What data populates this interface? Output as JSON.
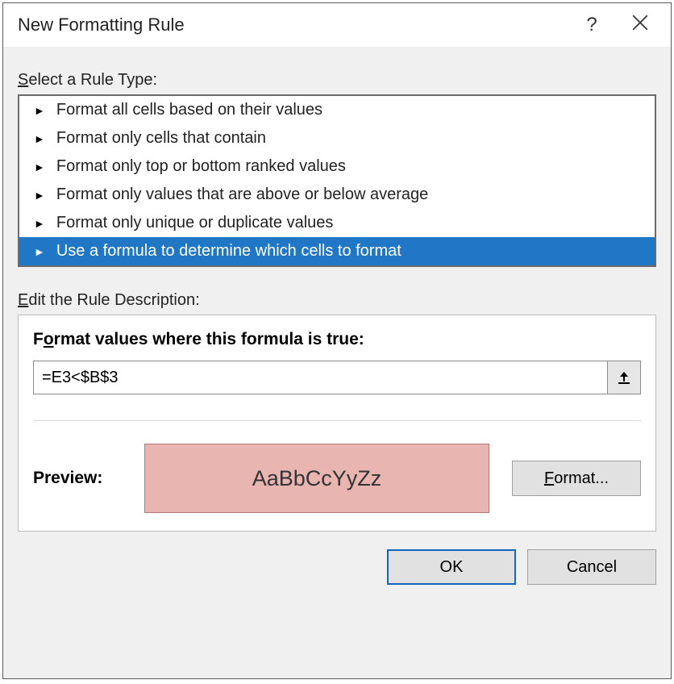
{
  "titlebar": {
    "title": "New Formatting Rule",
    "help": "?"
  },
  "sections": {
    "rule_type_label": "Select a Rule Type:",
    "rule_desc_label": "Edit the Rule Description:"
  },
  "rule_list": {
    "items": [
      "Format all cells based on their values",
      "Format only cells that contain",
      "Format only top or bottom ranked values",
      "Format only values that are above or below average",
      "Format only unique or duplicate values",
      "Use a formula to determine which cells to format"
    ],
    "selected_index": 5
  },
  "desc": {
    "label_pre": "F",
    "label_underline": "o",
    "label_post": "rmat values where this formula is true:",
    "formula_value": "=E3<$B$3"
  },
  "preview": {
    "label": "Preview:",
    "sample": "AaBbCcYyZz",
    "format_btn_pre": "",
    "format_btn_u": "F",
    "format_btn_post": "ormat...",
    "bg_color": "#e9b5b1",
    "border_color": "#b47a7a"
  },
  "buttons": {
    "ok": "OK",
    "cancel": "Cancel"
  }
}
